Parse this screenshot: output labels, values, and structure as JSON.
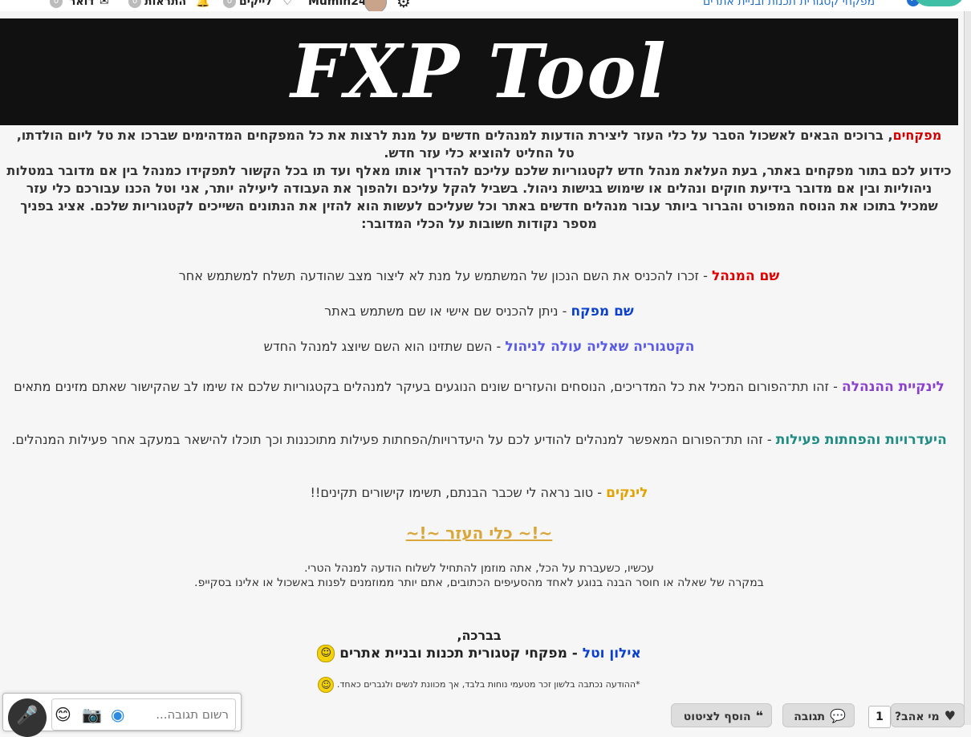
{
  "topbar": {
    "item1": "דואר",
    "item2": "התראות",
    "item3": "לייקים",
    "username": "Mumin24",
    "breadcrumb": "מפקחי קטגורית תכנות ובניית אתרים",
    "badges": [
      "0",
      "0",
      "0"
    ]
  },
  "banner": {
    "title": "FXP Tool"
  },
  "intro": {
    "highlight": "מפקחים",
    "rest": ", ברוכים הבאים לאשכול הסבר על כלי העזר ליצירת הודעות למנהלים חדשים על מנת לרצות את כל המפקחים המדהימים שברכו את טל ליום הולדתו, טל החליט להוציא כלי עזר חדש.",
    "para2": "כידוע לכם בתור מפקחים באתר, בעת העלאת מנהל חדש לקטגוריות שלכם עליכם להדריך אותו מאלף ועד תו בכל הקשור לתפקידו כמנהל בין אם מדובר במטלות ניהוליות ובין אם מדובר בידיעת חוקים ונהלים או שימוש בגישות ניהול. בשביל להקל עליכם ולהפוך את העבודה ליעילה יותר, אני וטל הכנו עבורכם כלי עזר שמכיל בתוכו את הנוסח המפורט והברור ביותר עבור מנהלים חדשים באתר וכל שעליכם לעשות הוא להזין את הנתונים השייכים לקטגוריות שלכם. אציג בפניך מספר נקודות חשובות על הכלי המדובר:"
  },
  "points": [
    {
      "term": "שם המנהל",
      "desc": " - זכרו להכניס את השם הנכון של המשתמש על מנת לא ליצור מצב שהודעה תשלח למשתמש אחר",
      "color": "#e00000"
    },
    {
      "term": "שם מפקח",
      "desc": " - ניתן להכניס שם אישי או שם משתמש באתר",
      "color": "#0a3fd0"
    },
    {
      "term": "הקטגוריה שאליה עולה לניהול",
      "desc": " - השם שתזינו הוא השם שיוצג למנהל החדש",
      "color": "#5a5ae6"
    },
    {
      "term": "לינקיית ההנהלה",
      "desc": " - זהו תת־הפורום המכיל את כל המדריכים, הנוסחים והעזרים שונים הנוגעים בעיקר למנהלים בקטגוריות שלכם אז שימו לב שהקישור שאתם מזינים מתאים",
      "color": "#8a3fcf"
    },
    {
      "term": "היעדרויות והפחתות פעילות",
      "desc": " - זהו תת־הפורום המאפשר למנהלים להודיע לכם על היעדרויות/הפחתות פעילות מתוכננות וכך תוכלו להישאר במעקב אחר פעילות המנהלים.",
      "color": "#1d8c82"
    },
    {
      "term": "לינקים",
      "desc": " - טוב נראה לי שכבר הבנתם, תשימו קישורים תקינים!!",
      "color": "#e2a300"
    }
  ],
  "tool_link": "~!~ כלי העזר ~!~",
  "outro": {
    "line1": "עכשיו, כשעברת על הכל, אתה מוזמן להתחיל לשלוח הודעה למנהל הטרי.",
    "line2": "במקרה של שאלה או חוסר הבנה בנוגע לאחד מהסעיפים הכתובים, אתם יותר ממוזמנים לפנות באשכול או אלינו בסקייפ."
  },
  "signature": {
    "greeting": "בברכה,",
    "names": "אילון וטל",
    "role": " - מפקחי קטגורית תכנות ובניית אתרים"
  },
  "note": "*ההודעה נכתבה בלשון זכר מטעמי נוחות בלבד, אך מכוונת לנשים ולגברים כאחד.",
  "reply": {
    "placeholder": "רשום תגובה..."
  },
  "actions": {
    "add_quote": "הוסף לציטוט",
    "reply": "תגובה",
    "who_likes": "מי אהב?",
    "likes_count": "1"
  },
  "colors": {
    "banner_bg": "#111111",
    "accent_blue": "#1f6ed0",
    "tool_link": "#d9a63a"
  },
  "icons": [
    "mail-icon",
    "bell-icon",
    "heart-icon",
    "gear-icon",
    "check-badge-icon",
    "mic-icon",
    "camera-icon",
    "emoji-icon",
    "quote-icon",
    "speech-bubble-icon"
  ]
}
